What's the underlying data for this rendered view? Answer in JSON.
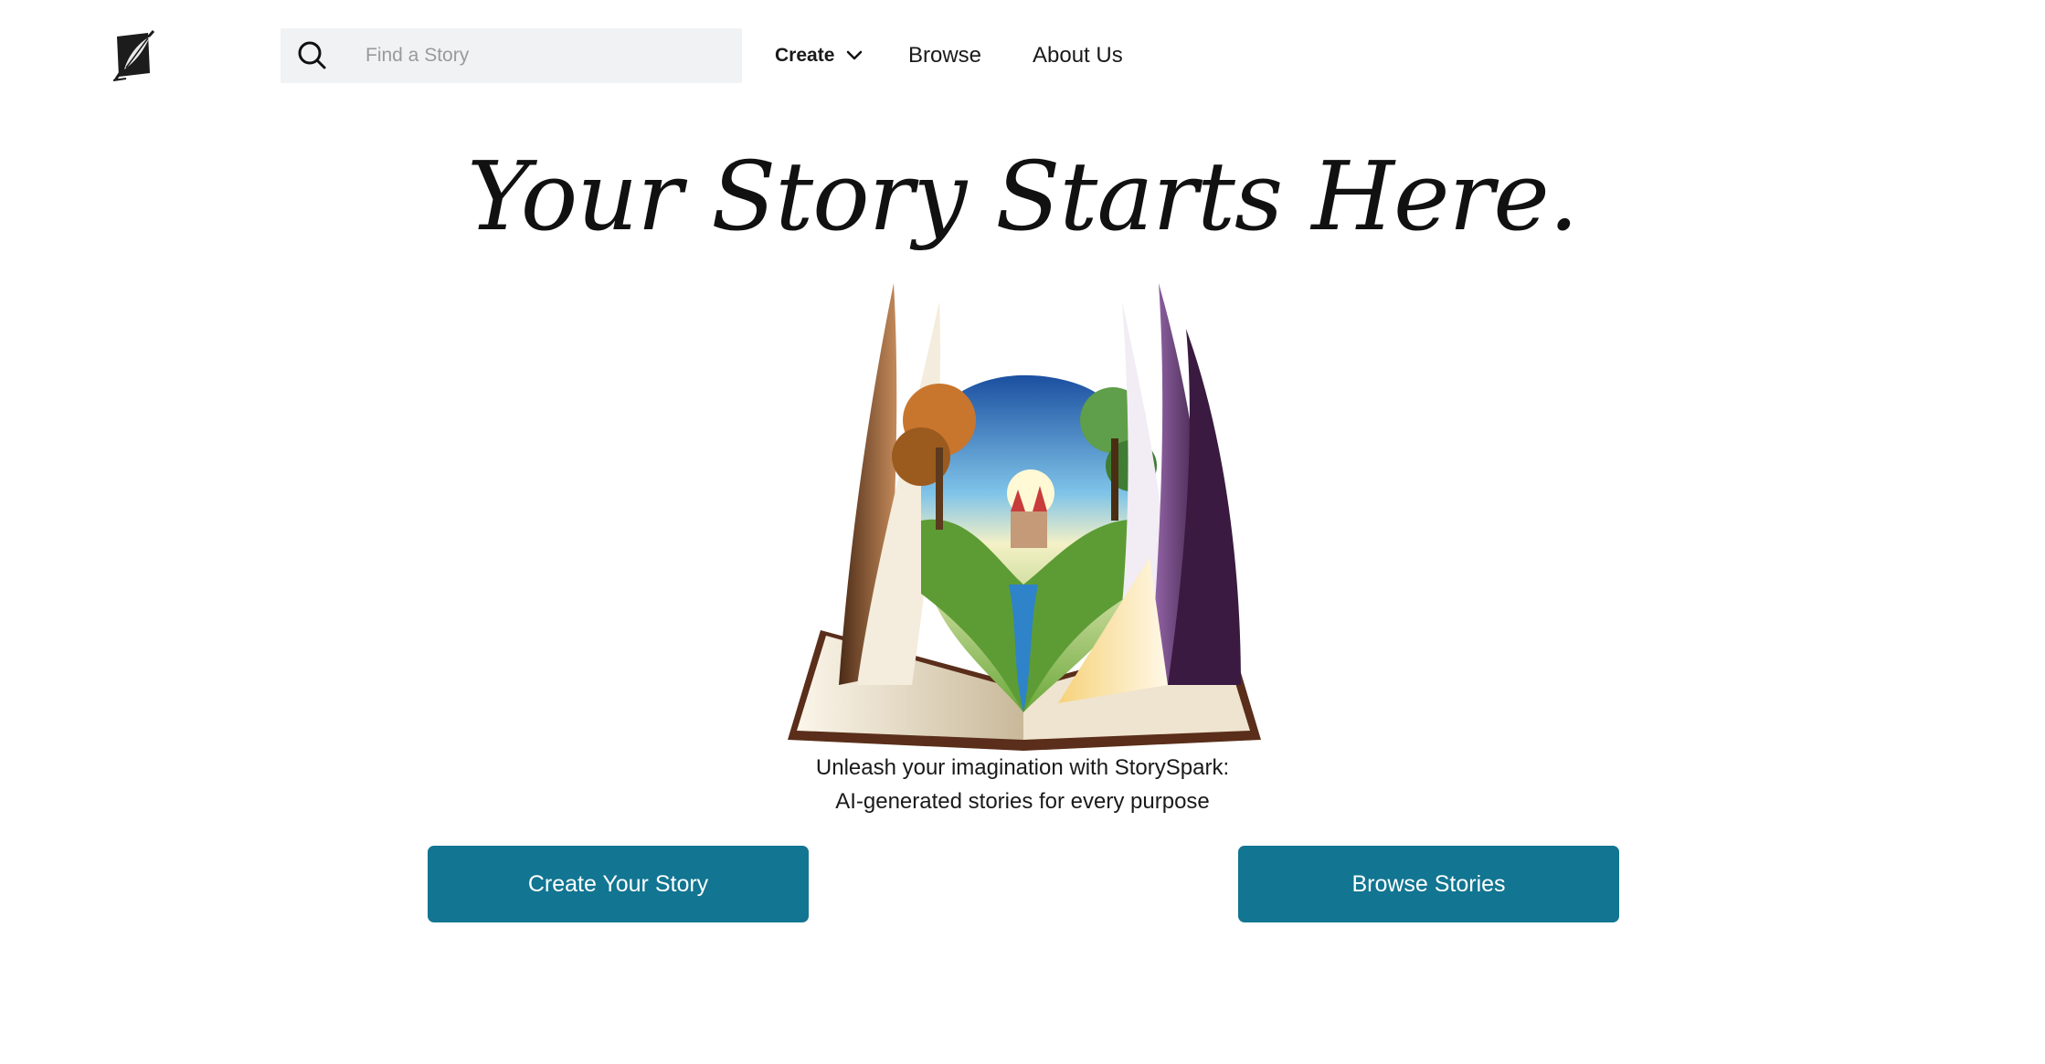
{
  "header": {
    "logo_icon": "quill-feather-icon",
    "search": {
      "placeholder": "Find a Story",
      "value": "",
      "icon": "search-icon"
    },
    "nav": {
      "create_label": "Create",
      "create_icon": "chevron-down-icon",
      "browse_label": "Browse",
      "about_label": "About Us"
    }
  },
  "hero": {
    "title": "Your Story Starts Here.",
    "image": "open-storybook-illustration",
    "tagline_line1": "Unleash your imagination with StorySpark:",
    "tagline_line2": "AI-generated stories for every purpose"
  },
  "actions": {
    "create_label": "Create Your Story",
    "browse_label": "Browse Stories"
  },
  "colors": {
    "button_bg": "#127591",
    "button_text": "#ffffff",
    "search_bg": "#f1f2f4"
  }
}
